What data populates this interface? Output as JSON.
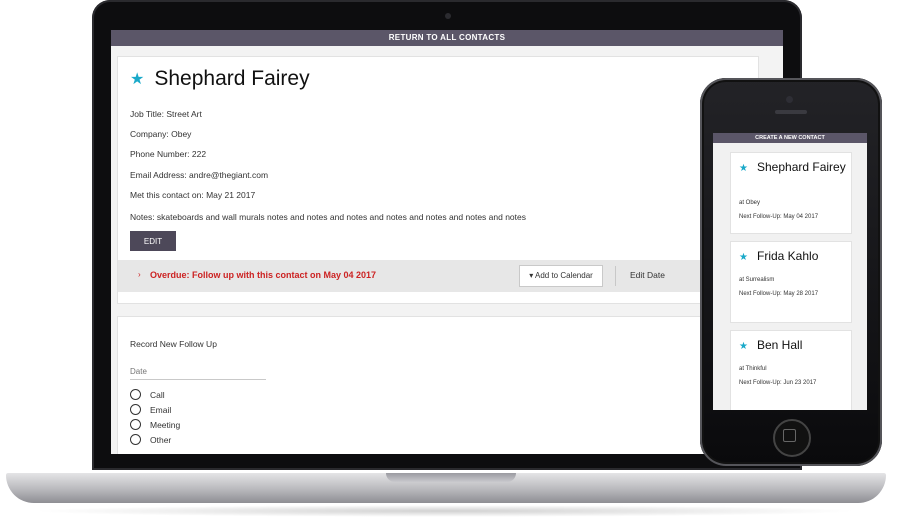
{
  "laptop": {
    "topbar_label": "RETURN TO ALL CONTACTS",
    "contact": {
      "name": "Shephard Fairey",
      "job_title": "Job Title: Street Art",
      "company": "Company: Obey",
      "phone": "Phone Number: 222",
      "email": "Email Address: andre@thegiant.com",
      "met": "Met this contact on: May 21 2017",
      "notes": "Notes: skateboards and wall murals notes and notes and notes and notes and notes and notes and notes"
    },
    "edit_label": "EDIT",
    "overdue_text": "Overdue: Follow up with this contact on May 04 2017",
    "add_calendar_label": "▾  Add to Calendar",
    "edit_date_label": "Edit Date",
    "record_label": "Record New Follow Up",
    "date_placeholder": "Date",
    "followup_types": [
      "Call",
      "Email",
      "Meeting",
      "Other"
    ]
  },
  "phone": {
    "topbar_label": "CREATE A NEW CONTACT",
    "contacts": [
      {
        "name": "Shephard Fairey",
        "company": "at Obey",
        "next": "Next Follow-Up: May 04 2017"
      },
      {
        "name": "Frida Kahlo",
        "company": "at Surrealism",
        "next": "Next Follow-Up: May 28 2017"
      },
      {
        "name": "Ben Hall",
        "company": "at Thinkful",
        "next": "Next Follow-Up: Jun 23 2017"
      }
    ]
  },
  "colors": {
    "accent": "#1aa9c9",
    "header": "#5b5668",
    "overdue": "#cc2222"
  },
  "icons": {
    "favorite": "star-icon",
    "radio": "radio-icon",
    "dropdown": "caret-down-icon"
  }
}
